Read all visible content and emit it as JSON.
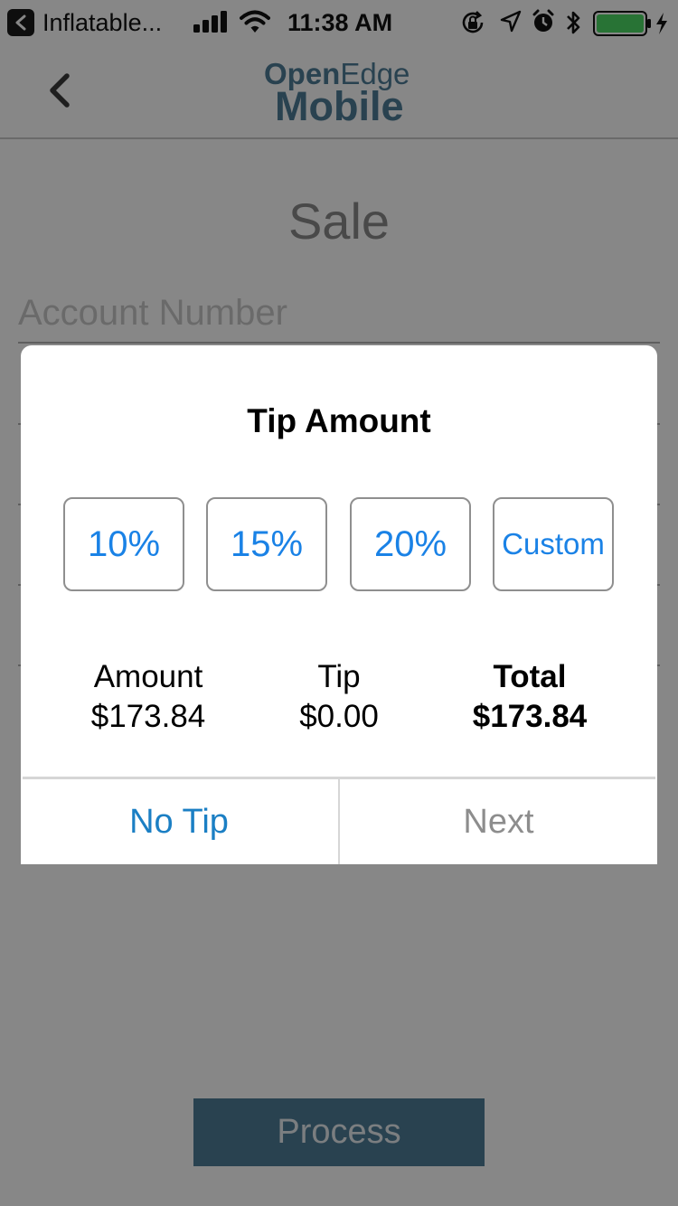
{
  "status_bar": {
    "back_app": "Inflatable...",
    "time": "11:38 AM",
    "icons": [
      "back-app-icon",
      "signal-icon",
      "wifi-icon",
      "rotation-lock-icon",
      "location-icon",
      "alarm-icon",
      "bluetooth-icon",
      "battery-icon",
      "charging-icon"
    ]
  },
  "nav": {
    "back_icon": "chevron-left-icon",
    "logo_top_bold": "Open",
    "logo_top_regular": "Edge",
    "logo_bottom": "Mobile"
  },
  "page": {
    "title": "Sale",
    "account_placeholder": "Account Number",
    "process_label": "Process"
  },
  "dialog": {
    "title": "Tip Amount",
    "options": [
      "10%",
      "15%",
      "20%",
      "Custom"
    ],
    "summary": {
      "amount_label": "Amount",
      "amount_value": "$173.84",
      "tip_label": "Tip",
      "tip_value": "$0.00",
      "total_label": "Total",
      "total_value": "$173.84"
    },
    "no_tip_label": "No Tip",
    "next_label": "Next"
  },
  "colors": {
    "brand": "#4e7d98",
    "option_text": "#1a82e6",
    "no_tip_text": "#1b7fc4",
    "disabled_text": "#8d8d8d",
    "battery": "#4cd964",
    "overlay": "rgba(0,0,0,0.47)"
  }
}
